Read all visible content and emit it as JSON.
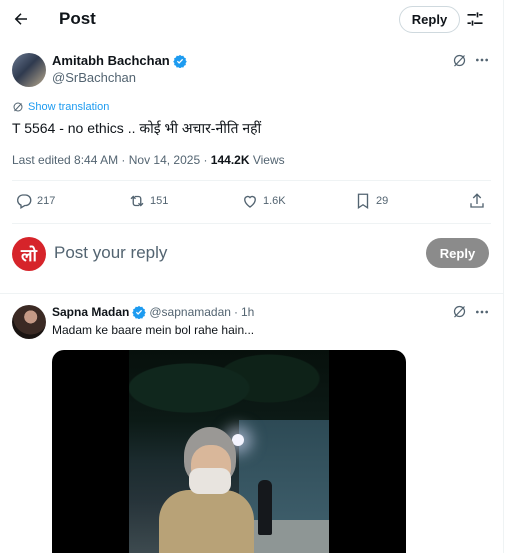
{
  "header": {
    "title": "Post",
    "reply_label": "Reply"
  },
  "post": {
    "author_name": "Amitabh Bachchan",
    "author_handle": "@SrBachchan",
    "show_translation": "Show translation",
    "text": "T 5564 - no ethics .. कोई भी अचार-नीति नहीं",
    "meta_prefix": "Last edited 8:44 AM · Nov 14, 2025 · ",
    "views_count": "144.2K",
    "views_label": " Views",
    "replies": "217",
    "reposts": "151",
    "likes": "1.6K",
    "bookmarks": "29"
  },
  "composer": {
    "avatar_letter": "लो",
    "placeholder": "Post your reply",
    "reply_button": "Reply"
  },
  "reply_tweet": {
    "author_name": "Sapna Madan",
    "author_handle": "@sapnamadan",
    "separator": "·",
    "time": "1h",
    "text": "Madam ke baare mein bol rahe hain..."
  },
  "colors": {
    "accent": "#1d9bf0",
    "muted": "#536471",
    "reply_button_disabled": "#8b8b8b",
    "avatar_brand": "#d6242a"
  }
}
